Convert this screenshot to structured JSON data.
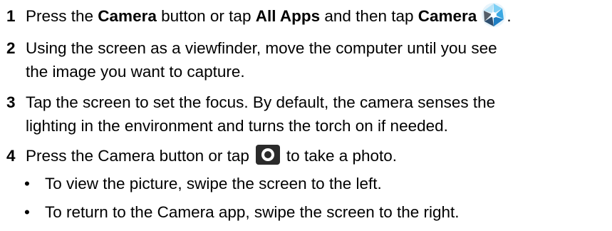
{
  "steps": [
    {
      "number": "1",
      "parts": {
        "a": "Press the ",
        "b": "Camera",
        "c": " button or tap ",
        "d": "All Apps",
        "e": " and then tap ",
        "f": "Camera",
        "g": "."
      },
      "icon": "camera-app-icon"
    },
    {
      "number": "2",
      "line1": "Using the screen as a viewfinder, move the computer until you see",
      "line2": "the image you want to capture."
    },
    {
      "number": "3",
      "line1": "Tap the screen to set the focus. By default, the camera senses the",
      "line2": "lighting in the environment and turns the torch on if needed."
    },
    {
      "number": "4",
      "before_icon": "Press the Camera button or tap",
      "after_icon": "to take a photo.",
      "icon": "camera-shutter-icon",
      "bullets": [
        "To view the picture, swipe the screen to the left.",
        "To return to the Camera app, swipe the screen to the right."
      ],
      "bullet_symbol": "•"
    }
  ],
  "colors": {
    "text": "#000000",
    "icon_blue_light": "#7fd0f5",
    "icon_blue_mid": "#3aa8e3",
    "icon_blue_dark": "#1f7fc4",
    "icon_dark": "#333333",
    "shutter_body": "#2b2b2b"
  }
}
